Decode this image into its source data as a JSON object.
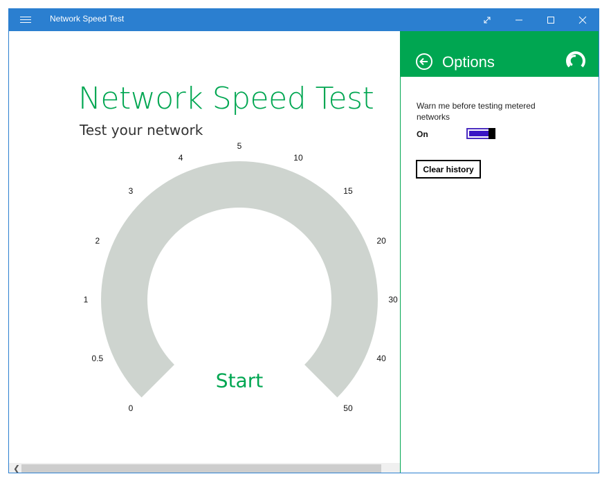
{
  "window": {
    "title": "Network Speed Test"
  },
  "main": {
    "heading": "Network Speed Test",
    "subheading": "Test your network",
    "start_label": "Start",
    "gauge_ticks": [
      "0",
      "0.5",
      "1",
      "2",
      "3",
      "4",
      "5",
      "10",
      "15",
      "20",
      "30",
      "40",
      "50"
    ]
  },
  "options": {
    "title": "Options",
    "warn_label": "Warn me before testing metered networks",
    "toggle_state": "On",
    "toggle_on": true,
    "clear_history_label": "Clear history"
  },
  "colors": {
    "titlebar": "#2b7fd0",
    "accent_green": "#00a651",
    "gauge_gray": "#ced4cf",
    "toggle_fill": "#3a16c4"
  },
  "icons": {
    "menu": "hamburger-icon",
    "restore": "expand-diagonal-icon",
    "minimize": "minimize-icon",
    "maximize": "maximize-icon",
    "close": "close-icon",
    "back": "back-arrow-icon",
    "logo": "speedometer-logo-icon"
  }
}
